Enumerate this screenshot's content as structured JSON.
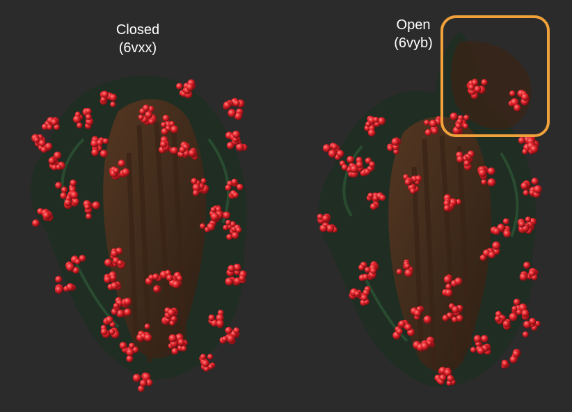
{
  "structures": {
    "closed": {
      "title": "Closed",
      "pdb_id": "(6vxx)"
    },
    "open": {
      "title": "Open",
      "pdb_id": "(6vyb)"
    }
  },
  "highlight": {
    "color": "#f0a13a"
  },
  "colors": {
    "background": "#2b2b2b",
    "glycan_red": "#e8262d",
    "protein_brown": "#4a2f1e",
    "protein_green": "#1f3d28"
  }
}
